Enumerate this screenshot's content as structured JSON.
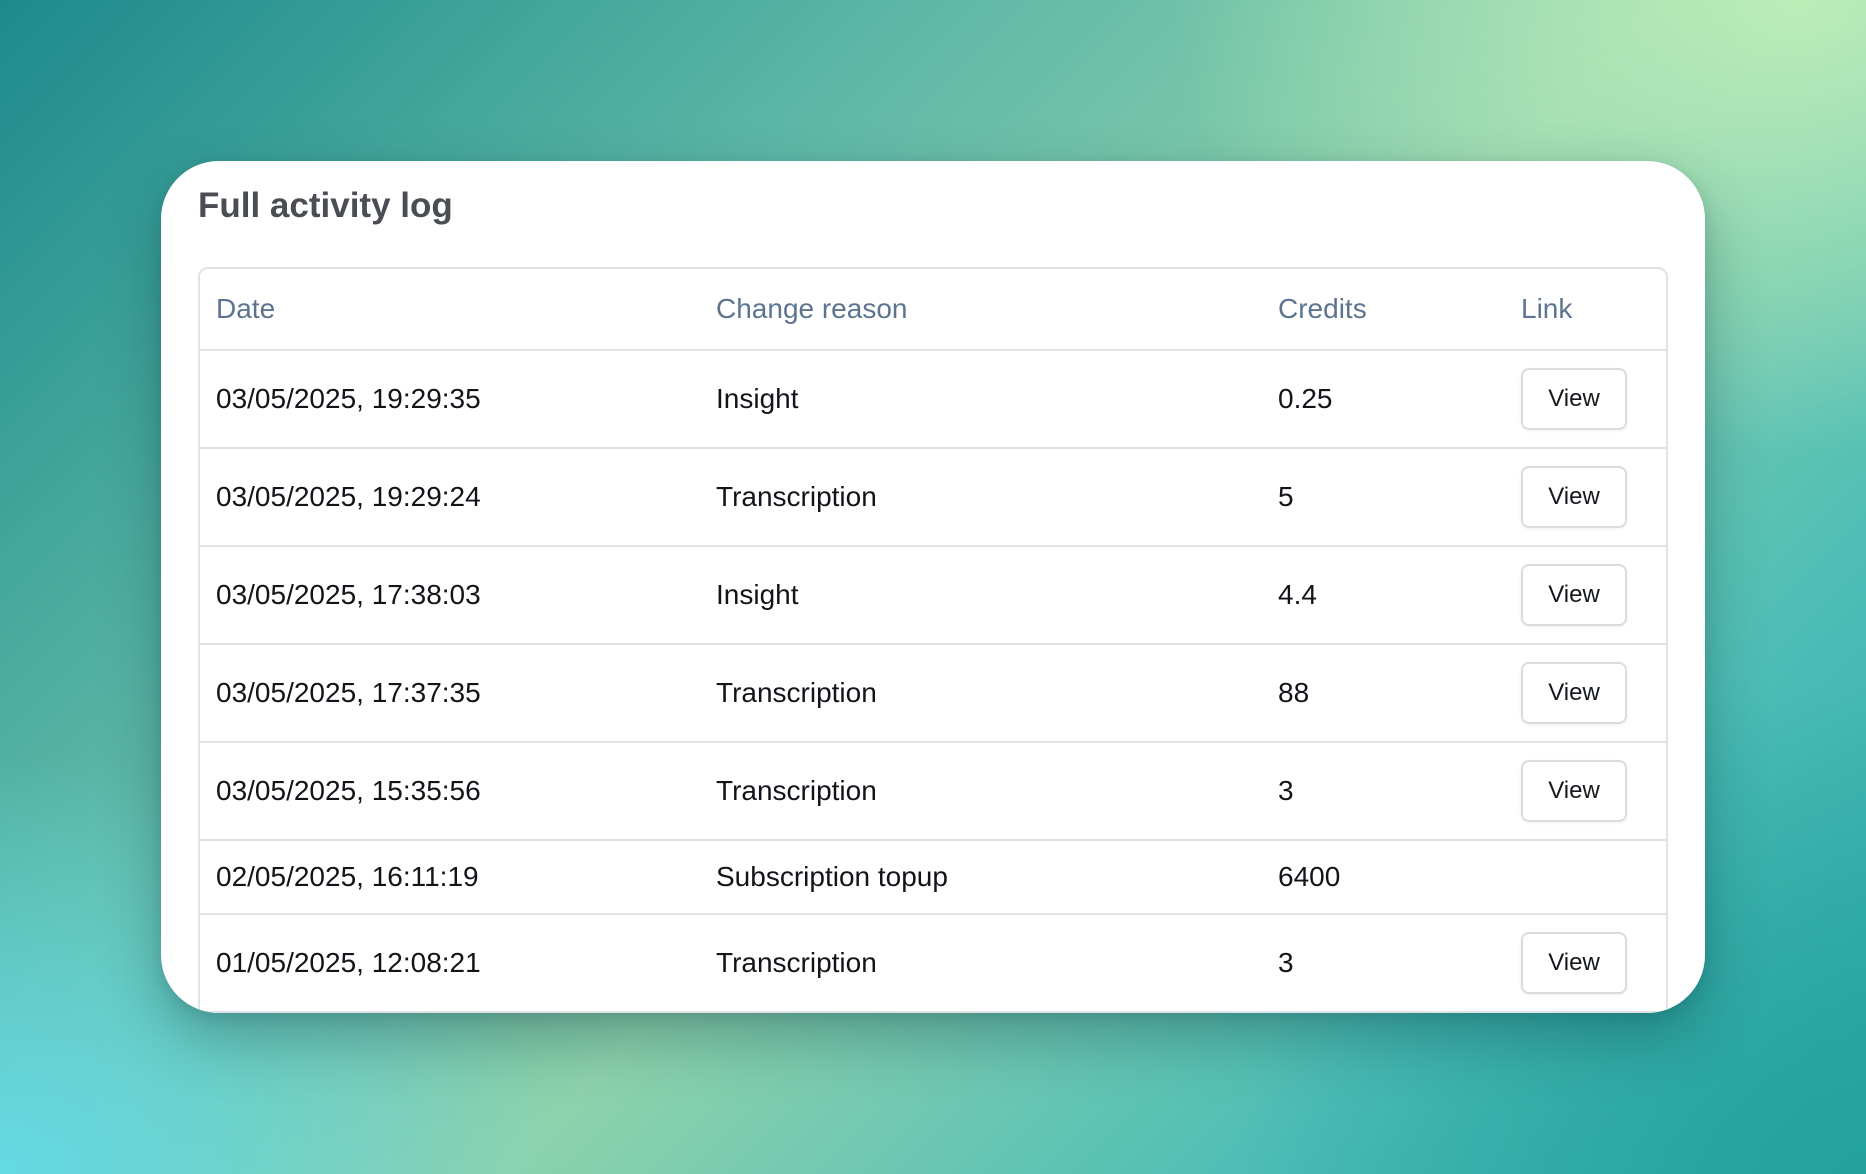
{
  "card": {
    "title": "Full activity log"
  },
  "table": {
    "headers": {
      "date": "Date",
      "reason": "Change reason",
      "credits": "Credits",
      "link": "Link"
    },
    "rows": [
      {
        "date": "03/05/2025, 19:29:35",
        "reason": "Insight",
        "credits": "0.25",
        "link": "View"
      },
      {
        "date": "03/05/2025, 19:29:24",
        "reason": "Transcription",
        "credits": "5",
        "link": "View"
      },
      {
        "date": "03/05/2025, 17:38:03",
        "reason": "Insight",
        "credits": "4.4",
        "link": "View"
      },
      {
        "date": "03/05/2025, 17:37:35",
        "reason": "Transcription",
        "credits": "88",
        "link": "View"
      },
      {
        "date": "03/05/2025, 15:35:56",
        "reason": "Transcription",
        "credits": "3",
        "link": "View"
      },
      {
        "date": "02/05/2025, 16:11:19",
        "reason": "Subscription topup",
        "credits": "6400",
        "link": ""
      },
      {
        "date": "01/05/2025, 12:08:21",
        "reason": "Transcription",
        "credits": "3",
        "link": "View"
      }
    ]
  },
  "colors": {
    "title": "#4a4e54",
    "header_text": "#5d7490",
    "row_text": "#111418",
    "border": "#dfe3e8"
  }
}
